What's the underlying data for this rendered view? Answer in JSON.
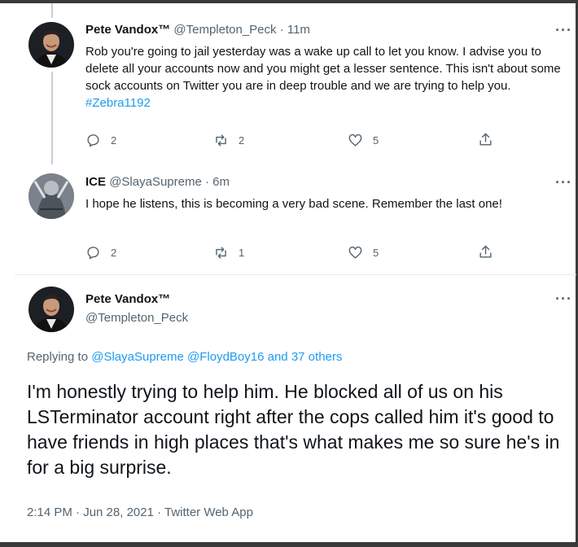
{
  "tweet1": {
    "name": "Pete Vandox™",
    "handle": "@Templeton_Peck",
    "sep": "·",
    "time": "11m",
    "text": "Rob you're going to jail yesterday was a wake up call to let you know. I advise you to delete all your accounts now and you might get a lesser sentence. This isn't about some sock accounts on Twitter you are in deep trouble and we are trying to help you.",
    "hashtag": "#Zebra1192",
    "more": "···",
    "reply_count": "2",
    "retweet_count": "2",
    "like_count": "5"
  },
  "tweet2": {
    "name": "ICE",
    "handle": "@SlayaSupreme",
    "sep": "·",
    "time": "6m",
    "text": "I hope he listens, this is becoming a very bad scene.  Remember the last one!",
    "more": "···",
    "reply_count": "2",
    "retweet_count": "1",
    "like_count": "5"
  },
  "main_tweet": {
    "name": "Pete Vandox™",
    "handle": "@Templeton_Peck",
    "more": "···",
    "replying_prefix": "Replying to",
    "replying_users": "@SlayaSupreme @FloydBoy16",
    "replying_and": "and",
    "replying_others": "37 others",
    "text": "I'm honestly trying to help him. He blocked all of us on his LSTerminator account right after the cops called him it's good to have friends in high places that's what makes me so sure he's in for a big surprise.",
    "timestamp": "2:14 PM · Jun 28, 2021 · Twitter Web App"
  },
  "colors": {
    "link": "#1d9bf0",
    "secondary_text": "#536471",
    "primary_text": "#0f1419",
    "thread_line": "#c4cfd6"
  },
  "icons": {
    "reply": "reply-icon",
    "retweet": "retweet-icon",
    "like": "like-icon",
    "share": "share-icon",
    "more": "more-icon"
  }
}
